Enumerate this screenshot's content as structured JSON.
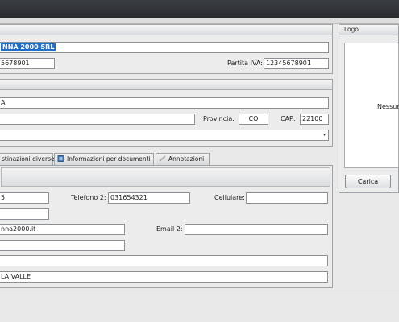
{
  "company": {
    "name_value": "NNA 2000 SRL",
    "code_value": "5678901",
    "vat_label": "Partita IVA:",
    "vat_value": "12345678901"
  },
  "address": {
    "street_value": "A",
    "city_value": "",
    "province_label": "Provincia:",
    "province_value": "CO",
    "cap_label": "CAP:",
    "cap_value": "22100"
  },
  "tabs": [
    {
      "label": "stinazioni diverse"
    },
    {
      "label": "Informazioni per documenti"
    },
    {
      "label": "Annotazioni"
    }
  ],
  "contacts": {
    "phone1_value": "5",
    "phone2_label": "Telefono 2:",
    "phone2_value": "031654321",
    "mobile_label": "Cellulare:",
    "mobile_value": "",
    "fax_value": "",
    "email1_value": "nna2000.it",
    "email2_label": "Email 2:",
    "email2_value": "",
    "web_value": "",
    "notes_value": "",
    "bottom_value": "LA VALLE"
  },
  "logo": {
    "title": "Logo",
    "placeholder": "Nessun",
    "load_button": "Carica"
  },
  "colors": {
    "selection": "#1f6fc9",
    "titlebar": "#2a2c30"
  }
}
